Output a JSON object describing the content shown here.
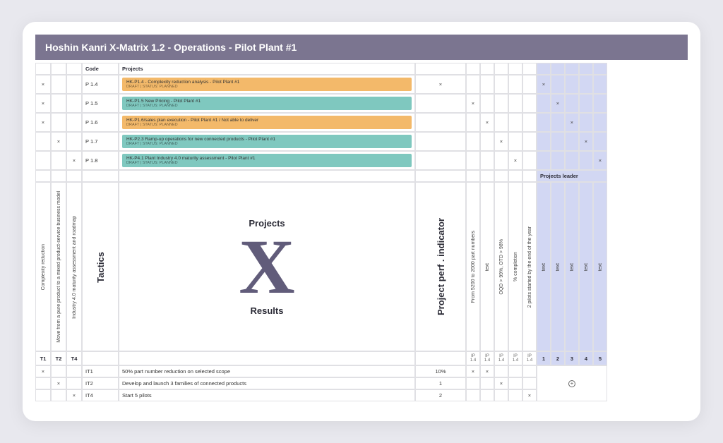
{
  "title": "Hoshin Kanri X-Matrix 1.2 - Operations - Pilot Plant #1",
  "headers": {
    "code": "Code",
    "projects": "Projects",
    "projects_leader": "Projects leader"
  },
  "center": {
    "projects": "Projects",
    "tactics": "Tactics",
    "ppi": "Project perf . indicator",
    "results": "Results",
    "x": "X"
  },
  "cols_left": {
    "c1": "Complexity reduction",
    "c2": "Move from a pure product to a mixed product-service business model",
    "c3": "Industry 4.0 maturity assessment and roadmap"
  },
  "kpi": {
    "k1": "From 5200 to 2000 part numbers",
    "k2": "text",
    "k3": "OQD > 99%, OTD > 98%",
    "k4": "% completion",
    "k5": "2 pilots started by the end of the year"
  },
  "leaders": {
    "l1": "text",
    "l2": "text",
    "l3": "text",
    "l4": "text",
    "l5": "text"
  },
  "bottom_labels": {
    "t1": "T1",
    "t2": "T2",
    "t4": "T4",
    "ip14": "IP 1.4",
    "n1": "1",
    "n2": "2",
    "n3": "3",
    "n4": "4",
    "n5": "5"
  },
  "projects": [
    {
      "code": "P 1.4",
      "title": "HK-P1.4 - Complexity reduction analysis - Pilot Plant #1",
      "sub": "DRAFT | STATUS: PLANNED",
      "color": "orange"
    },
    {
      "code": "P 1.5",
      "title": "HK-P1.5 New Pricing - Pilot Plant #1",
      "sub": "DRAFT | STATUS: PLANNED",
      "color": "teal"
    },
    {
      "code": "P 1.6",
      "title": "HK-P1.6/sales plan execution - Pilot Plant #1 / Not able to deliver",
      "sub": "DRAFT | STATUS: PLANNED",
      "color": "orange"
    },
    {
      "code": "P 1.7",
      "title": "HK-P2.3 Ramp-up operations for new connected products - Pilot Plant #1",
      "sub": "DRAFT | STATUS: PLANNED",
      "color": "teal"
    },
    {
      "code": "P 1.8",
      "title": "HK-P4.1 Plant Industry 4.0 maturity assessment - Pilot Plant #1",
      "sub": "DRAFT | STATUS: PLANNED",
      "color": "teal"
    }
  ],
  "results": [
    {
      "code": "IT1",
      "text": "50% part number reduction on selected scope",
      "target": "10%"
    },
    {
      "code": "IT2",
      "text": "Develop and launch 3 families of connected products",
      "target": "1"
    },
    {
      "code": "IT4",
      "text": "Start 5 pilots",
      "target": "2"
    }
  ],
  "mark": "×",
  "plus": "+"
}
